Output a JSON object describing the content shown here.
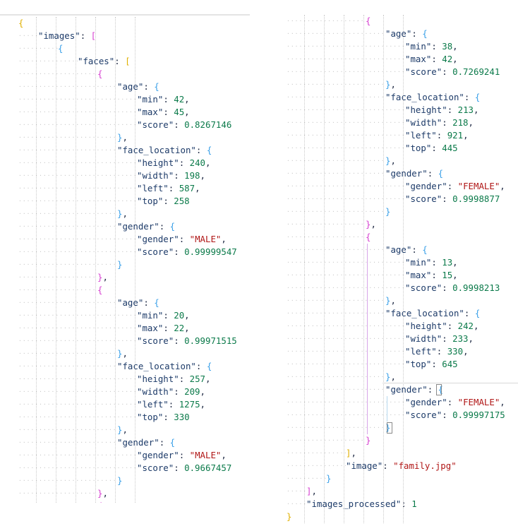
{
  "left": {
    "lines": [
      {
        "indent": 0,
        "parts": [
          [
            "b1",
            "{"
          ]
        ]
      },
      {
        "indent": 1,
        "parts": [
          [
            "key",
            "\"images\""
          ],
          [
            "p",
            ": "
          ],
          [
            "b2",
            "["
          ]
        ]
      },
      {
        "indent": 2,
        "parts": [
          [
            "b3",
            "{"
          ]
        ]
      },
      {
        "indent": 3,
        "parts": [
          [
            "key",
            "\"faces\""
          ],
          [
            "p",
            ": "
          ],
          [
            "b1",
            "["
          ]
        ]
      },
      {
        "indent": 4,
        "parts": [
          [
            "b2",
            "{"
          ]
        ]
      },
      {
        "indent": 5,
        "parts": [
          [
            "key",
            "\"age\""
          ],
          [
            "p",
            ": "
          ],
          [
            "b3",
            "{"
          ]
        ]
      },
      {
        "indent": 6,
        "parts": [
          [
            "key",
            "\"min\""
          ],
          [
            "p",
            ": "
          ],
          [
            "num",
            "42"
          ],
          [
            "p",
            ","
          ]
        ]
      },
      {
        "indent": 6,
        "parts": [
          [
            "key",
            "\"max\""
          ],
          [
            "p",
            ": "
          ],
          [
            "num",
            "45"
          ],
          [
            "p",
            ","
          ]
        ]
      },
      {
        "indent": 6,
        "parts": [
          [
            "key",
            "\"score\""
          ],
          [
            "p",
            ": "
          ],
          [
            "num",
            "0.8267146"
          ]
        ]
      },
      {
        "indent": 5,
        "parts": [
          [
            "b3",
            "}"
          ],
          [
            "p",
            ","
          ]
        ]
      },
      {
        "indent": 5,
        "parts": [
          [
            "key",
            "\"face_location\""
          ],
          [
            "p",
            ": "
          ],
          [
            "b3",
            "{"
          ]
        ]
      },
      {
        "indent": 6,
        "parts": [
          [
            "key",
            "\"height\""
          ],
          [
            "p",
            ": "
          ],
          [
            "num",
            "240"
          ],
          [
            "p",
            ","
          ]
        ]
      },
      {
        "indent": 6,
        "parts": [
          [
            "key",
            "\"width\""
          ],
          [
            "p",
            ": "
          ],
          [
            "num",
            "198"
          ],
          [
            "p",
            ","
          ]
        ]
      },
      {
        "indent": 6,
        "parts": [
          [
            "key",
            "\"left\""
          ],
          [
            "p",
            ": "
          ],
          [
            "num",
            "587"
          ],
          [
            "p",
            ","
          ]
        ]
      },
      {
        "indent": 6,
        "parts": [
          [
            "key",
            "\"top\""
          ],
          [
            "p",
            ": "
          ],
          [
            "num",
            "258"
          ]
        ]
      },
      {
        "indent": 5,
        "parts": [
          [
            "b3",
            "}"
          ],
          [
            "p",
            ","
          ]
        ]
      },
      {
        "indent": 5,
        "parts": [
          [
            "key",
            "\"gender\""
          ],
          [
            "p",
            ": "
          ],
          [
            "b3",
            "{"
          ]
        ]
      },
      {
        "indent": 6,
        "parts": [
          [
            "key",
            "\"gender\""
          ],
          [
            "p",
            ": "
          ],
          [
            "str",
            "\"MALE\""
          ],
          [
            "p",
            ","
          ]
        ]
      },
      {
        "indent": 6,
        "parts": [
          [
            "key",
            "\"score\""
          ],
          [
            "p",
            ": "
          ],
          [
            "num",
            "0.99999547"
          ]
        ]
      },
      {
        "indent": 5,
        "parts": [
          [
            "b3",
            "}"
          ]
        ]
      },
      {
        "indent": 4,
        "parts": [
          [
            "b2",
            "}"
          ],
          [
            "p",
            ","
          ]
        ]
      },
      {
        "indent": 4,
        "parts": [
          [
            "b2",
            "{"
          ]
        ]
      },
      {
        "indent": 5,
        "parts": [
          [
            "key",
            "\"age\""
          ],
          [
            "p",
            ": "
          ],
          [
            "b3",
            "{"
          ]
        ]
      },
      {
        "indent": 6,
        "parts": [
          [
            "key",
            "\"min\""
          ],
          [
            "p",
            ": "
          ],
          [
            "num",
            "20"
          ],
          [
            "p",
            ","
          ]
        ]
      },
      {
        "indent": 6,
        "parts": [
          [
            "key",
            "\"max\""
          ],
          [
            "p",
            ": "
          ],
          [
            "num",
            "22"
          ],
          [
            "p",
            ","
          ]
        ]
      },
      {
        "indent": 6,
        "parts": [
          [
            "key",
            "\"score\""
          ],
          [
            "p",
            ": "
          ],
          [
            "num",
            "0.99971515"
          ]
        ]
      },
      {
        "indent": 5,
        "parts": [
          [
            "b3",
            "}"
          ],
          [
            "p",
            ","
          ]
        ]
      },
      {
        "indent": 5,
        "parts": [
          [
            "key",
            "\"face_location\""
          ],
          [
            "p",
            ": "
          ],
          [
            "b3",
            "{"
          ]
        ]
      },
      {
        "indent": 6,
        "parts": [
          [
            "key",
            "\"height\""
          ],
          [
            "p",
            ": "
          ],
          [
            "num",
            "257"
          ],
          [
            "p",
            ","
          ]
        ]
      },
      {
        "indent": 6,
        "parts": [
          [
            "key",
            "\"width\""
          ],
          [
            "p",
            ": "
          ],
          [
            "num",
            "209"
          ],
          [
            "p",
            ","
          ]
        ]
      },
      {
        "indent": 6,
        "parts": [
          [
            "key",
            "\"left\""
          ],
          [
            "p",
            ": "
          ],
          [
            "num",
            "1275"
          ],
          [
            "p",
            ","
          ]
        ]
      },
      {
        "indent": 6,
        "parts": [
          [
            "key",
            "\"top\""
          ],
          [
            "p",
            ": "
          ],
          [
            "num",
            "330"
          ]
        ]
      },
      {
        "indent": 5,
        "parts": [
          [
            "b3",
            "}"
          ],
          [
            "p",
            ","
          ]
        ]
      },
      {
        "indent": 5,
        "parts": [
          [
            "key",
            "\"gender\""
          ],
          [
            "p",
            ": "
          ],
          [
            "b3",
            "{"
          ]
        ]
      },
      {
        "indent": 6,
        "parts": [
          [
            "key",
            "\"gender\""
          ],
          [
            "p",
            ": "
          ],
          [
            "str",
            "\"MALE\""
          ],
          [
            "p",
            ","
          ]
        ]
      },
      {
        "indent": 6,
        "parts": [
          [
            "key",
            "\"score\""
          ],
          [
            "p",
            ": "
          ],
          [
            "num",
            "0.9667457"
          ]
        ]
      },
      {
        "indent": 5,
        "parts": [
          [
            "b3",
            "}"
          ]
        ]
      },
      {
        "indent": 4,
        "parts": [
          [
            "b2",
            "}"
          ],
          [
            "p",
            ","
          ]
        ]
      },
      {
        "indent": 4,
        "parts": [
          [
            "b2",
            "{"
          ]
        ]
      }
    ]
  },
  "right": {
    "lines": [
      {
        "indent": 4,
        "parts": [
          [
            "b2",
            "{"
          ]
        ]
      },
      {
        "indent": 5,
        "parts": [
          [
            "key",
            "\"age\""
          ],
          [
            "p",
            ": "
          ],
          [
            "b3",
            "{"
          ]
        ]
      },
      {
        "indent": 6,
        "parts": [
          [
            "key",
            "\"min\""
          ],
          [
            "p",
            ": "
          ],
          [
            "num",
            "38"
          ],
          [
            "p",
            ","
          ]
        ]
      },
      {
        "indent": 6,
        "parts": [
          [
            "key",
            "\"max\""
          ],
          [
            "p",
            ": "
          ],
          [
            "num",
            "42"
          ],
          [
            "p",
            ","
          ]
        ]
      },
      {
        "indent": 6,
        "parts": [
          [
            "key",
            "\"score\""
          ],
          [
            "p",
            ": "
          ],
          [
            "num",
            "0.7269241"
          ]
        ]
      },
      {
        "indent": 5,
        "parts": [
          [
            "b3",
            "}"
          ],
          [
            "p",
            ","
          ]
        ]
      },
      {
        "indent": 5,
        "parts": [
          [
            "key",
            "\"face_location\""
          ],
          [
            "p",
            ": "
          ],
          [
            "b3",
            "{"
          ]
        ]
      },
      {
        "indent": 6,
        "parts": [
          [
            "key",
            "\"height\""
          ],
          [
            "p",
            ": "
          ],
          [
            "num",
            "213"
          ],
          [
            "p",
            ","
          ]
        ]
      },
      {
        "indent": 6,
        "parts": [
          [
            "key",
            "\"width\""
          ],
          [
            "p",
            ": "
          ],
          [
            "num",
            "218"
          ],
          [
            "p",
            ","
          ]
        ]
      },
      {
        "indent": 6,
        "parts": [
          [
            "key",
            "\"left\""
          ],
          [
            "p",
            ": "
          ],
          [
            "num",
            "921"
          ],
          [
            "p",
            ","
          ]
        ]
      },
      {
        "indent": 6,
        "parts": [
          [
            "key",
            "\"top\""
          ],
          [
            "p",
            ": "
          ],
          [
            "num",
            "445"
          ]
        ]
      },
      {
        "indent": 5,
        "parts": [
          [
            "b3",
            "}"
          ],
          [
            "p",
            ","
          ]
        ]
      },
      {
        "indent": 5,
        "parts": [
          [
            "key",
            "\"gender\""
          ],
          [
            "p",
            ": "
          ],
          [
            "b3",
            "{"
          ]
        ]
      },
      {
        "indent": 6,
        "parts": [
          [
            "key",
            "\"gender\""
          ],
          [
            "p",
            ": "
          ],
          [
            "str",
            "\"FEMALE\""
          ],
          [
            "p",
            ","
          ]
        ]
      },
      {
        "indent": 6,
        "parts": [
          [
            "key",
            "\"score\""
          ],
          [
            "p",
            ": "
          ],
          [
            "num",
            "0.9998877"
          ]
        ]
      },
      {
        "indent": 5,
        "parts": [
          [
            "b3",
            "}"
          ]
        ]
      },
      {
        "indent": 4,
        "parts": [
          [
            "b2",
            "}"
          ],
          [
            "p",
            ","
          ]
        ]
      },
      {
        "indent": 4,
        "parts": [
          [
            "b2",
            "{"
          ]
        ]
      },
      {
        "indent": 5,
        "parts": [
          [
            "key",
            "\"age\""
          ],
          [
            "p",
            ": "
          ],
          [
            "b3",
            "{"
          ]
        ]
      },
      {
        "indent": 6,
        "parts": [
          [
            "key",
            "\"min\""
          ],
          [
            "p",
            ": "
          ],
          [
            "num",
            "13"
          ],
          [
            "p",
            ","
          ]
        ]
      },
      {
        "indent": 6,
        "parts": [
          [
            "key",
            "\"max\""
          ],
          [
            "p",
            ": "
          ],
          [
            "num",
            "15"
          ],
          [
            "p",
            ","
          ]
        ]
      },
      {
        "indent": 6,
        "parts": [
          [
            "key",
            "\"score\""
          ],
          [
            "p",
            ": "
          ],
          [
            "num",
            "0.9998213"
          ]
        ]
      },
      {
        "indent": 5,
        "parts": [
          [
            "b3",
            "}"
          ],
          [
            "p",
            ","
          ]
        ]
      },
      {
        "indent": 5,
        "parts": [
          [
            "key",
            "\"face_location\""
          ],
          [
            "p",
            ": "
          ],
          [
            "b3",
            "{"
          ]
        ]
      },
      {
        "indent": 6,
        "parts": [
          [
            "key",
            "\"height\""
          ],
          [
            "p",
            ": "
          ],
          [
            "num",
            "242"
          ],
          [
            "p",
            ","
          ]
        ]
      },
      {
        "indent": 6,
        "parts": [
          [
            "key",
            "\"width\""
          ],
          [
            "p",
            ": "
          ],
          [
            "num",
            "233"
          ],
          [
            "p",
            ","
          ]
        ]
      },
      {
        "indent": 6,
        "parts": [
          [
            "key",
            "\"left\""
          ],
          [
            "p",
            ": "
          ],
          [
            "num",
            "330"
          ],
          [
            "p",
            ","
          ]
        ]
      },
      {
        "indent": 6,
        "parts": [
          [
            "key",
            "\"top\""
          ],
          [
            "p",
            ": "
          ],
          [
            "num",
            "645"
          ]
        ]
      },
      {
        "indent": 5,
        "parts": [
          [
            "b3",
            "}"
          ],
          [
            "p",
            ","
          ]
        ]
      },
      {
        "indent": 5,
        "parts": [
          [
            "key",
            "\"gender\""
          ],
          [
            "p",
            ": "
          ],
          [
            "b3",
            "{"
          ]
        ]
      },
      {
        "indent": 6,
        "parts": [
          [
            "key",
            "\"gender\""
          ],
          [
            "p",
            ": "
          ],
          [
            "str",
            "\"FEMALE\""
          ],
          [
            "p",
            ","
          ]
        ]
      },
      {
        "indent": 6,
        "parts": [
          [
            "key",
            "\"score\""
          ],
          [
            "p",
            ": "
          ],
          [
            "num",
            "0.99997175"
          ]
        ]
      },
      {
        "indent": 5,
        "parts": [
          [
            "b3",
            "}"
          ]
        ]
      },
      {
        "indent": 4,
        "parts": [
          [
            "b2",
            "}"
          ]
        ]
      },
      {
        "indent": 3,
        "parts": [
          [
            "b1",
            "]"
          ],
          [
            "p",
            ","
          ]
        ]
      },
      {
        "indent": 3,
        "parts": [
          [
            "key",
            "\"image\""
          ],
          [
            "p",
            ": "
          ],
          [
            "str",
            "\"family.jpg\""
          ]
        ]
      },
      {
        "indent": 2,
        "parts": [
          [
            "b3",
            "}"
          ]
        ]
      },
      {
        "indent": 1,
        "parts": [
          [
            "b2",
            "]"
          ],
          [
            "p",
            ","
          ]
        ]
      },
      {
        "indent": 1,
        "parts": [
          [
            "key",
            "\"images_processed\""
          ],
          [
            "p",
            ": "
          ],
          [
            "num",
            "1"
          ]
        ]
      },
      {
        "indent": 0,
        "parts": [
          [
            "b1",
            "}"
          ]
        ]
      }
    ]
  }
}
